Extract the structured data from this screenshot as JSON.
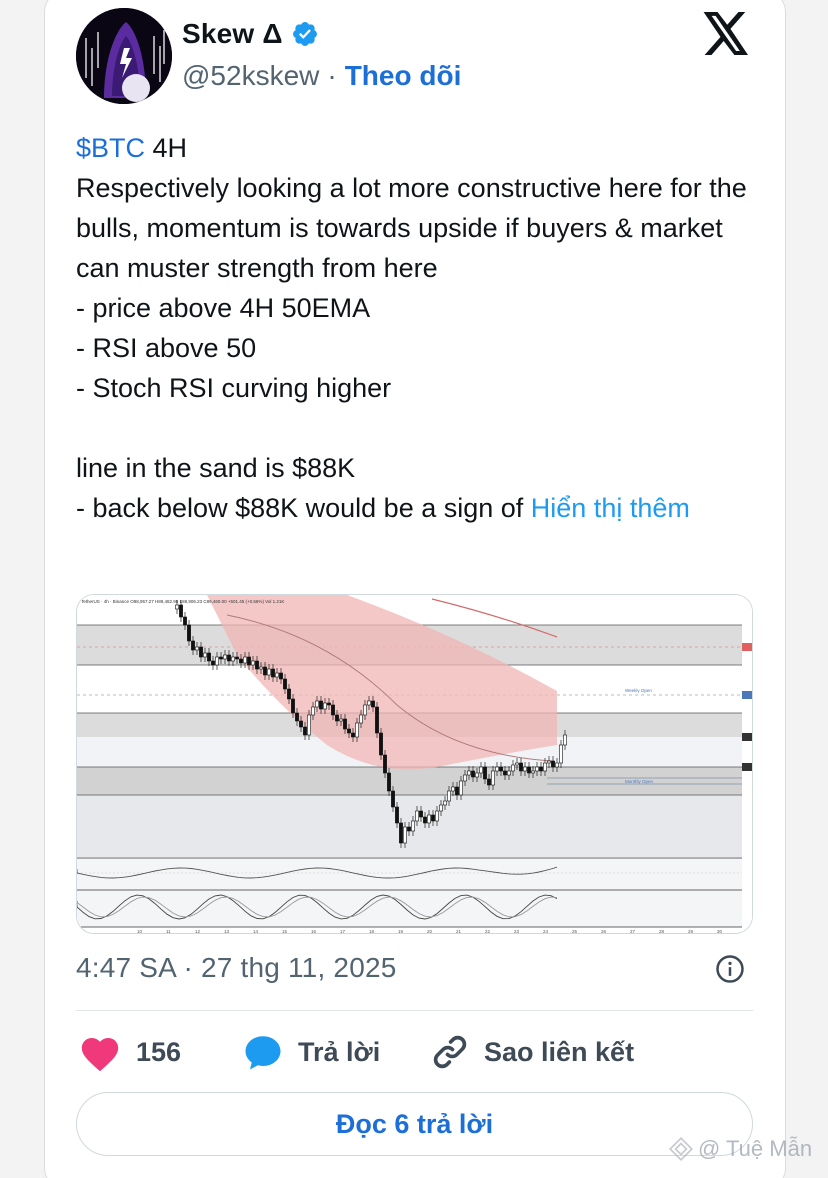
{
  "author": {
    "display_name": "Skew Δ",
    "handle": "@52kskew",
    "separator": "·",
    "follow_label": "Theo dõi",
    "verified": true
  },
  "tweet": {
    "cashtag": "$BTC",
    "text_after_cashtag": " 4H\nRespectively looking a lot more constructive here for the bulls, momentum is towards upside if buyers & market can muster strength from here\n- price above 4H 50EMA\n- RSI above 50\n- Stoch RSI curving higher\n\nline in the sand is $88K\n- back below $88K would be a sign of ",
    "show_more_label": "Hiển thị thêm"
  },
  "media": {
    "header_text": "TetherUS · 4h · Binance  O88,957.27  H89,482.95  L88,906.23  C89,460.00  +501.45 (+0.56%)  Vol 1.21K",
    "annotation_right": "Weekly Open",
    "annotation_level": "Monthly Open",
    "x_ticks": [
      "10",
      "11",
      "12",
      "13",
      "14",
      "15",
      "16",
      "17",
      "18",
      "19",
      "20",
      "21",
      "22",
      "23",
      "24",
      "25",
      "26",
      "27",
      "28",
      "29",
      "30",
      "Dec",
      "2"
    ]
  },
  "timestamp": "4:47 SA · 27 thg 11, 2025",
  "actions": {
    "like_count": "156",
    "reply_label": "Trả lời",
    "copy_link_label": "Sao liên kết"
  },
  "read_replies_label": "Đọc 6 trả lời",
  "watermark": "@ Tuệ Mẫn",
  "colors": {
    "link_blue": "#1d6fd8",
    "like_pink": "#f0397a",
    "reply_blue": "#1d9bf0",
    "verified_blue": "#1d9bf0"
  }
}
